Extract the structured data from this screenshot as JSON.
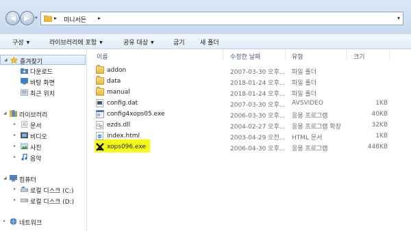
{
  "address": {
    "back_icon": "back-arrow-icon",
    "forward_icon": "forward-arrow-icon",
    "crumb_sep": "▸",
    "current_folder": "미니서든",
    "history_caret": "▾",
    "address_dropdown": "▾"
  },
  "toolbar": {
    "items": [
      {
        "label": "구성",
        "caret": "▼"
      },
      {
        "label": "라이브러리에 포함",
        "caret": "▼"
      },
      {
        "label": "공유 대상",
        "caret": "▼"
      },
      {
        "label": "굽기",
        "caret": ""
      },
      {
        "label": "새 폴더",
        "caret": ""
      }
    ]
  },
  "nav": {
    "favorites": {
      "label": "즐겨찾기",
      "icon": "star-icon"
    },
    "favorite_items": [
      {
        "label": "다운로드",
        "icon": "download-folder-icon"
      },
      {
        "label": "바탕 화면",
        "icon": "desktop-icon"
      },
      {
        "label": "최근 위치",
        "icon": "recent-places-icon"
      }
    ],
    "libraries": {
      "label": "라이브러리",
      "icon": "library-icon"
    },
    "library_items": [
      {
        "label": "문서",
        "icon": "documents-icon"
      },
      {
        "label": "비디오",
        "icon": "video-icon"
      },
      {
        "label": "사진",
        "icon": "pictures-icon"
      },
      {
        "label": "음악",
        "icon": "music-icon"
      }
    ],
    "computer": {
      "label": "컴퓨터",
      "icon": "computer-icon"
    },
    "computer_items": [
      {
        "label": "로컬 디스크 (C:)",
        "icon": "local-disk-icon"
      },
      {
        "label": "로컬 디스크 (D:)",
        "icon": "local-disk-icon"
      }
    ],
    "network": {
      "label": "네트워크",
      "icon": "network-icon"
    },
    "expand_arrow": "▸",
    "collapse_arrow": "◢"
  },
  "columns": {
    "name": "이름",
    "date": "수정한 날짜",
    "type": "유형",
    "size": "크기"
  },
  "files": [
    {
      "name": "addon",
      "date": "2007-03-30 오후...",
      "type": "파일 폴더",
      "size": "",
      "icon": "folder-icon"
    },
    {
      "name": "data",
      "date": "2018-01-24 오후...",
      "type": "파일 폴더",
      "size": "",
      "icon": "folder-icon"
    },
    {
      "name": "manual",
      "date": "2018-01-24 오후...",
      "type": "파일 폴더",
      "size": "",
      "icon": "folder-icon"
    },
    {
      "name": "config.dat",
      "date": "2007-03-30 오후...",
      "type": "AVSVIDEO",
      "size": "1KB",
      "icon": "dat-file-icon"
    },
    {
      "name": "config4xops05.exe",
      "date": "2006-03-30 오후...",
      "type": "응용 프로그램",
      "size": "40KB",
      "icon": "exe-file-icon"
    },
    {
      "name": "ezds.dll",
      "date": "2004-02-27 오후...",
      "type": "응용 프로그램 확장",
      "size": "32KB",
      "icon": "dll-file-icon"
    },
    {
      "name": "index.html",
      "date": "2003-04-29 오전...",
      "type": "HTML 문서",
      "size": "1KB",
      "icon": "html-file-icon"
    },
    {
      "name": "xops096.exe",
      "date": "2006-04-30 오후...",
      "type": "응용 프로그램",
      "size": "448KB",
      "icon": "xops-app-icon"
    }
  ],
  "colors": {
    "highlight": "#f6fb12",
    "accent": "#9dc0e9"
  }
}
